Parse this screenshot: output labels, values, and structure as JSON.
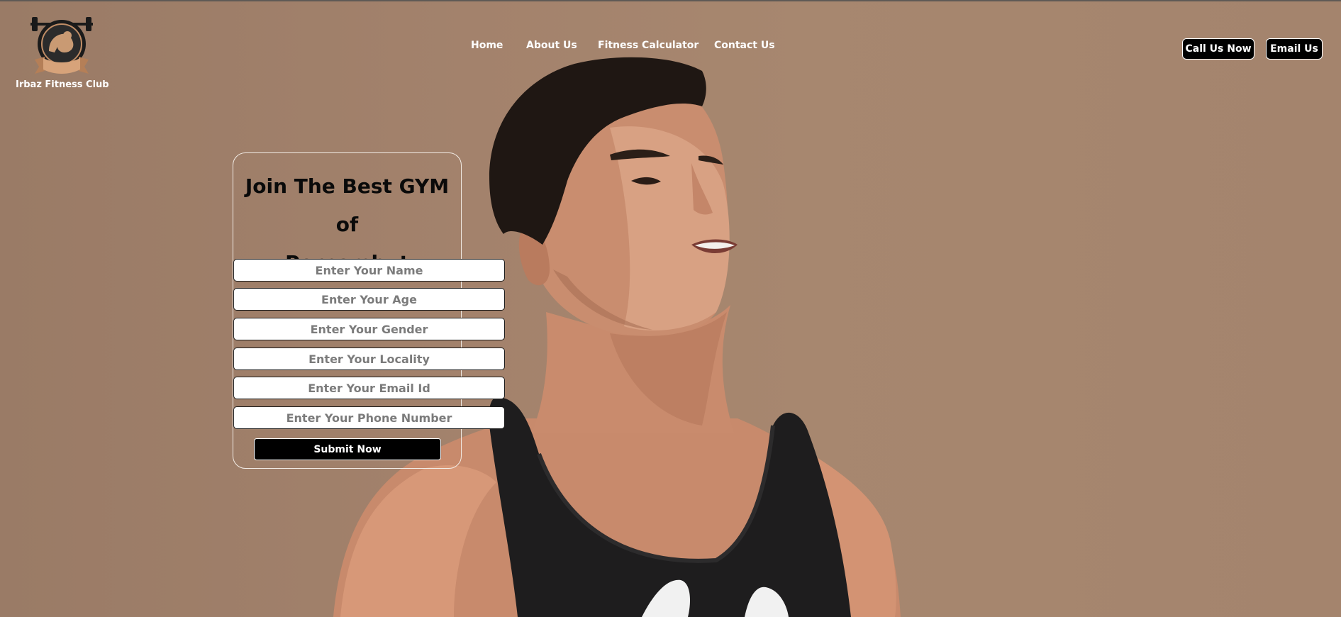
{
  "brand": {
    "name": "Irbaz Fitness Club"
  },
  "nav": {
    "items": [
      {
        "label": "Home"
      },
      {
        "label": "About Us"
      },
      {
        "label": "Fitness Calculator"
      },
      {
        "label": "Contact Us"
      }
    ]
  },
  "header_buttons": {
    "call": "Call Us Now",
    "email": "Email Us"
  },
  "form": {
    "title_line1": "Join The Best GYM of",
    "title_line2": "Pernambut",
    "fields": [
      {
        "placeholder": "Enter Your Name"
      },
      {
        "placeholder": "Enter Your Age"
      },
      {
        "placeholder": "Enter Your Gender"
      },
      {
        "placeholder": "Enter Your Locality"
      },
      {
        "placeholder": "Enter Your Email Id"
      },
      {
        "placeholder": "Enter Your Phone Number"
      }
    ],
    "submit_label": "Submit Now"
  },
  "colors": {
    "background": "#a3836c",
    "button": "#000000",
    "text_light": "#ffffff",
    "title_text": "#0a0a0a"
  }
}
